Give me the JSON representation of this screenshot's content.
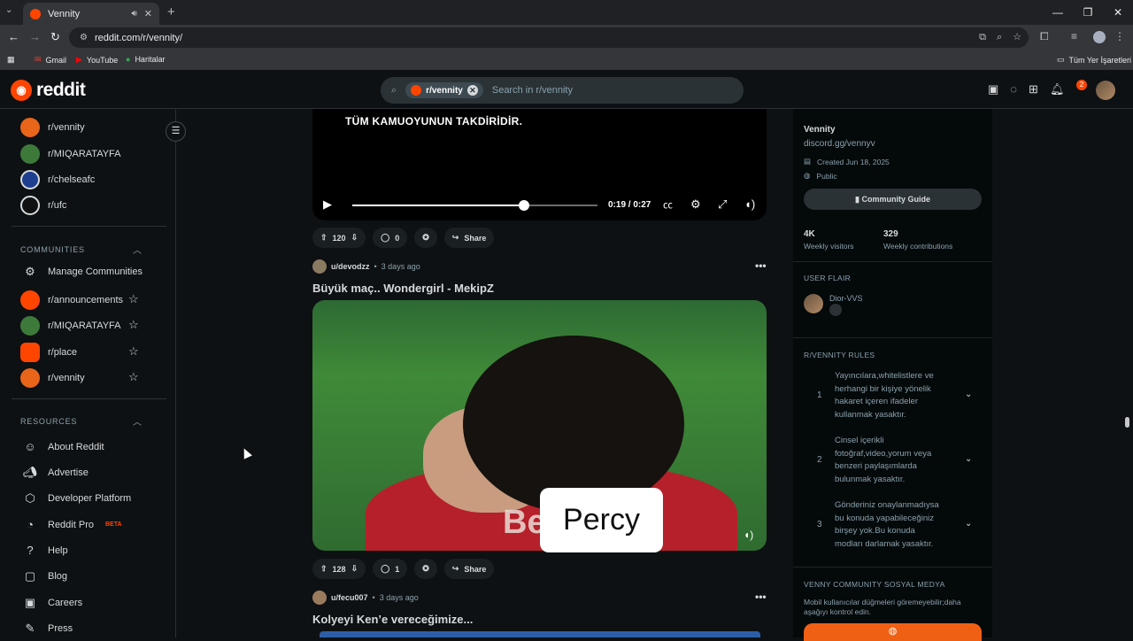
{
  "browser": {
    "tab_title": "Vennity",
    "url": "reddit.com/r/vennity/",
    "bookmarks": [
      "Gmail",
      "YouTube",
      "Haritalar"
    ],
    "bookmarks_folder": "Tüm Yer İşaretleri"
  },
  "header": {
    "brand": "reddit",
    "search_chip": "r/vennity",
    "search_placeholder": "Search in r/vennity",
    "notif_count": "2"
  },
  "sidebar": {
    "recent": [
      "r/vennity",
      "r/MIQARATAYFA",
      "r/chelseafc",
      "r/ufc"
    ],
    "communities_title": "COMMUNITIES",
    "manage": "Manage Communities",
    "communities": [
      "r/announcements",
      "r/MIQARATAYFA",
      "r/place",
      "r/vennity"
    ],
    "resources_title": "RESOURCES",
    "resources": [
      "About Reddit",
      "Advertise",
      "Developer Platform",
      "Reddit Pro",
      "Help",
      "Blog",
      "Careers",
      "Press"
    ],
    "beta": "BETA"
  },
  "feed": {
    "video1": {
      "caption": "TÜM KAMUOYUNUN TAKDİRİDİR.",
      "time": "0:19 / 0:27",
      "progress": 0.7
    },
    "post1_actions": {
      "votes": "120",
      "comments": "0",
      "share": "Share"
    },
    "post2": {
      "user": "u/devodzz",
      "time": "3 days ago",
      "title": "Büyük maç.. Wondergirl - MekipZ",
      "shirt_text": "Be      ov",
      "overlay": "Percy",
      "votes": "128",
      "comments": "1",
      "share": "Share"
    },
    "post3": {
      "user": "u/fecu007",
      "time": "3 days ago",
      "title": "Kolyeyi Ken’e vereceğimize..."
    }
  },
  "right": {
    "name": "Vennity",
    "link": "discord.gg/vennyv",
    "created": "Created Jun 18, 2025",
    "visibility": "Public",
    "guide_btn": "Community Guide",
    "visitors_val": "4K",
    "visitors_label": "Weekly visitors",
    "contrib_val": "329",
    "contrib_label": "Weekly contributions",
    "user_flair_title": "USER FLAIR",
    "flair_name": "Dior-VVS",
    "rules_title": "R/VENNITY RULES",
    "rules": [
      {
        "n": "1",
        "text": "Yayıncılara,whitelistlere ve herhangi bir kişiye yönelik hakaret içeren ifadeler kullanmak yasaktır."
      },
      {
        "n": "2",
        "text": "Cinsel içerikli fotoğraf,video,yorum veya benzeri paylaşımlarda bulunmak yasaktır."
      },
      {
        "n": "3",
        "text": "Gönderiniz onaylanmadıysa bu konuda yapabileceğiniz birşey yok.Bu konuda modları darlamak yasaktır."
      }
    ],
    "social_title": "VENNY COMMUNITY SOSYAL MEDYA",
    "social_text": "Mobil kullanıcılar düğmeleri göremeyebilir;daha aşağıyı kontrol edin."
  }
}
